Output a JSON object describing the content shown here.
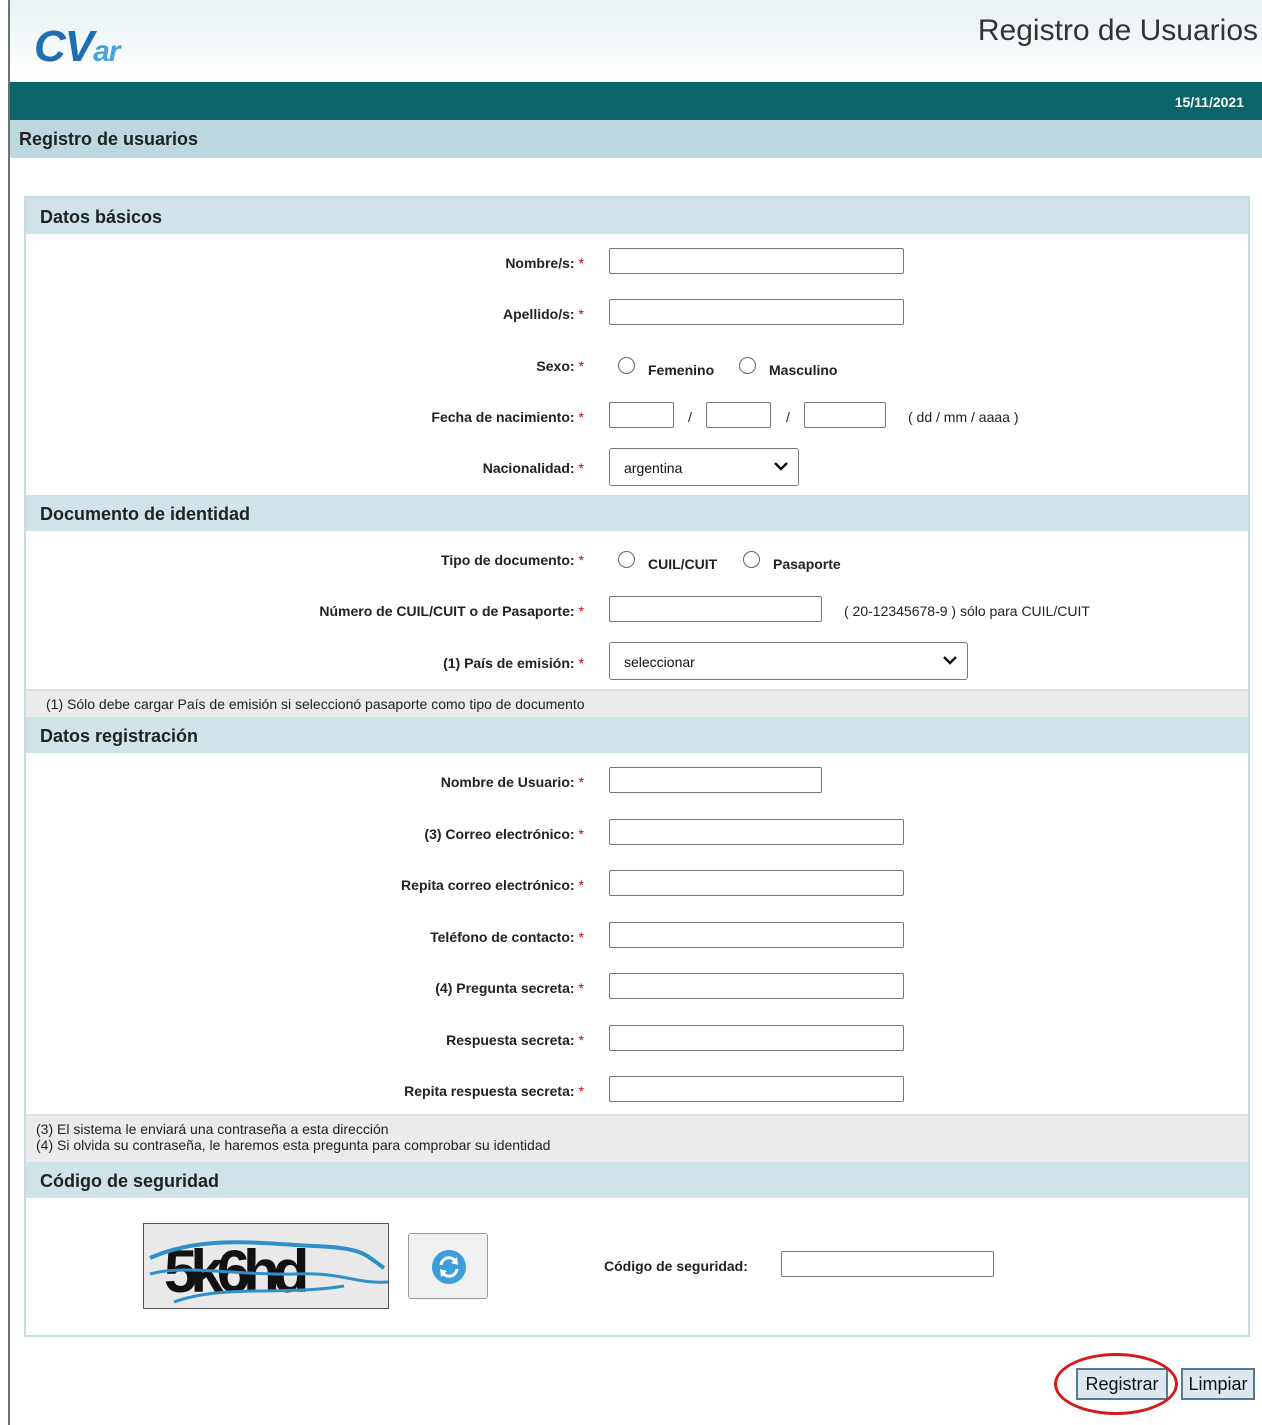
{
  "header": {
    "logo_main": "CV",
    "logo_suffix": "ar",
    "app_title": "Registro de Usuarios",
    "date": "15/11/2021",
    "page_title": "Registro de usuarios"
  },
  "required_mark": "*",
  "sections": {
    "basic": "Datos básicos",
    "document": "Documento de identidad",
    "registration": "Datos registración",
    "security": "Código de seguridad"
  },
  "basic": {
    "nombre_label": "Nombre/s:",
    "apellido_label": "Apellido/s:",
    "sexo_label": "Sexo:",
    "sexo_options": [
      "Femenino",
      "Masculino"
    ],
    "fecha_label": "Fecha de nacimiento:",
    "fecha_sep": "/",
    "fecha_hint": "( dd / mm / aaaa )",
    "nacionalidad_label": "Nacionalidad:",
    "nacionalidad_value": "argentina"
  },
  "document": {
    "tipo_label": "Tipo de documento:",
    "tipo_options": [
      "CUIL/CUIT",
      "Pasaporte"
    ],
    "numero_label": "Número de CUIL/CUIT o de Pasaporte:",
    "numero_hint": "( 20-12345678-9 ) sólo para CUIL/CUIT",
    "pais_label": "(1) País de emisión:",
    "pais_value": "seleccionar",
    "note": "(1) Sólo debe cargar País de emisión si seleccionó pasaporte como tipo de documento"
  },
  "registration": {
    "usuario_label": "Nombre de Usuario:",
    "correo_label": "(3) Correo electrónico:",
    "repita_correo_label": "Repita correo electrónico:",
    "telefono_label": "Teléfono de contacto:",
    "pregunta_label": "(4) Pregunta secreta:",
    "respuesta_label": "Respuesta secreta:",
    "repita_respuesta_label": "Repita respuesta secreta:",
    "note1": "(3) El sistema le enviará una contraseña a esta dirección",
    "note2": "(4) Si olvida su contraseña, le haremos esta pregunta para comprobar su identidad"
  },
  "security": {
    "captcha_text": "5k6hd",
    "codigo_label": "Código de seguridad:"
  },
  "buttons": {
    "registrar": "Registrar",
    "limpiar": "Limpiar"
  },
  "colors": {
    "header_bar": "#0a6468",
    "section_bg": "#cfe3e8",
    "required": "#cc0000",
    "highlight_oval": "#d21c1c"
  }
}
